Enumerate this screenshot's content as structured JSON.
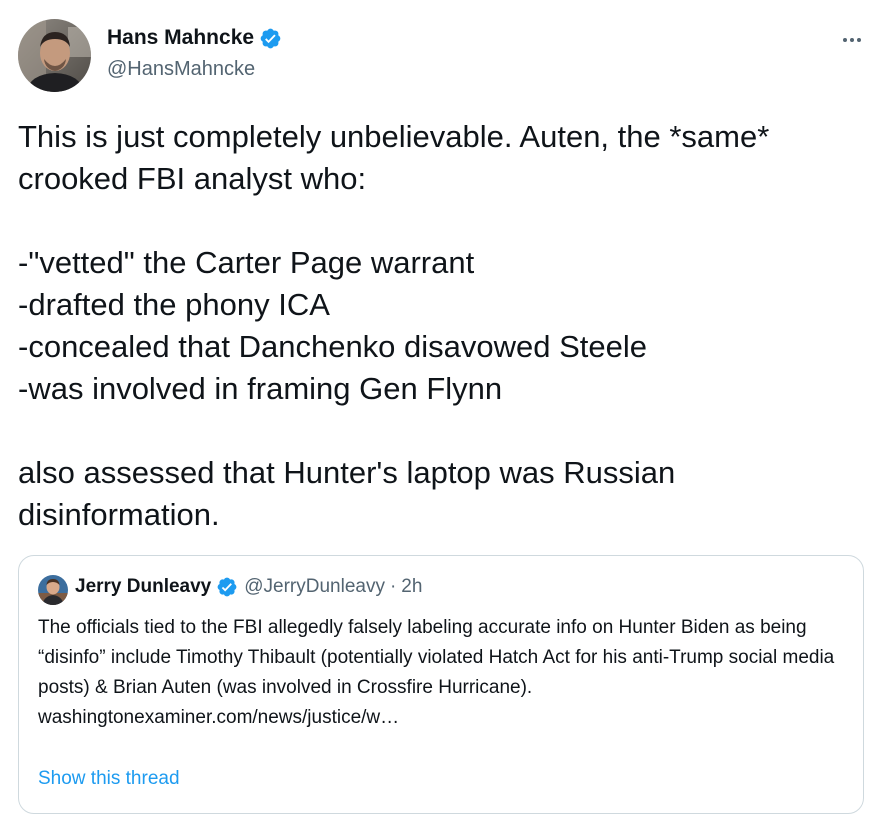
{
  "tweet": {
    "author": {
      "name": "Hans Mahncke",
      "handle": "@HansMahncke",
      "verified": true
    },
    "text": "This is just completely unbelievable. Auten, the *same* crooked FBI analyst who:\n\n-\"vetted\" the Carter Page warrant\n-drafted the phony ICA\n-concealed that Danchenko disavowed Steele\n-was involved in framing Gen Flynn\n\nalso assessed that Hunter's laptop was Russian disinformation.",
    "more_icon": "more-horizontal-icon"
  },
  "quote": {
    "author": {
      "name": "Jerry Dunleavy",
      "handle": "@JerryDunleavy",
      "separator": "·",
      "time": "2h",
      "verified": true
    },
    "text": "The officials tied to the FBI allegedly falsely labeling accurate info on Hunter Biden as being “disinfo” include Timothy Thibault (potentially violated Hatch Act for his anti-Trump social media posts) & Brian Auten (was involved in Crossfire Hurricane).",
    "link": "washingtonexaminer.com/news/justice/w…",
    "show_thread": "Show this thread"
  },
  "colors": {
    "text_primary": "#0f1419",
    "text_secondary": "#536471",
    "accent": "#1d9bf0",
    "border": "#cfd9de"
  }
}
